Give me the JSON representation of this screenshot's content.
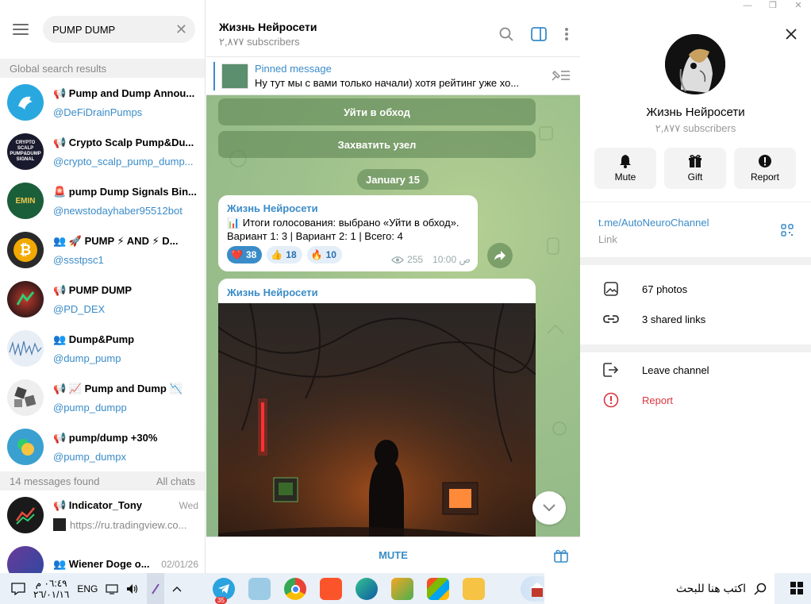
{
  "window": {
    "minimize": "—",
    "restore": "❐",
    "close": "✕"
  },
  "left_panel": {
    "search": {
      "value": "PUMP DUMP"
    },
    "global_header": "Global search results",
    "global_results": [
      {
        "title": "📢 Pump and Dump Annou...",
        "sub": "@DeFiDrainPumps",
        "avatar_color": "#29a8e0"
      },
      {
        "title": "📢 Crypto Scalp Pump&Du...",
        "sub": "@crypto_scalp_pump_dump...",
        "avatar_color": "#1a1a2e",
        "avatar_text": "CRYPTO SCALP PUMP&DUMP SIGNAL"
      },
      {
        "title": "🚨 pump Dump Signals Bin...",
        "sub": "@newstodayhaber95512bot",
        "avatar_color": "#1b5e3a",
        "avatar_text": "EMIN"
      },
      {
        "title": "👥 🚀 PUMP ⚡ AND ⚡ D...",
        "sub": "@ssstpsc1",
        "avatar_color": "#2a2a2a"
      },
      {
        "title": "📢 PUMP DUMP",
        "sub": "@PD_DEX",
        "avatar_color": "#3a1a1a"
      },
      {
        "title": "👥 Dump&Pump",
        "sub": "@dump_pump",
        "avatar_color": "#e8eef6"
      },
      {
        "title": "📢 📈 Pump and Dump 📉",
        "sub": "@pump_dumpp",
        "avatar_color": "#eeeeee"
      },
      {
        "title": "📢 pump/dump +30%",
        "sub": "@pump_dumpx",
        "avatar_color": "#3aa0d0"
      }
    ],
    "messages_header": {
      "left": "14 messages found",
      "right": "All chats"
    },
    "message_results": [
      {
        "title": "📢 Indicator_Tony",
        "date": "Wed",
        "sub": "https://ru.tradingview.co...",
        "avatar_color": "#1a1a1a"
      },
      {
        "title": "👥 Wiener Doge o...",
        "date": "02/01/26",
        "sub": "",
        "avatar_color": "#4a2a6a"
      }
    ]
  },
  "chat": {
    "title": "Жизнь Нейросети",
    "subscribers": "٢,٨٧٧ subscribers",
    "pinned": {
      "label": "Pinned message",
      "text": "Ну тут мы с вами только начали) хотя рейтинг уже хо..."
    },
    "keyboard_buttons": [
      "Уйти в обход",
      "Захватить узел"
    ],
    "date_pill": "January 15",
    "poll_message": {
      "author": "Жизнь Нейросети",
      "line1": "📊 Итоги голосования: выбрано «Уйти в обход».",
      "line2": "Вариант 1: 3 | Вариант 2: 1 | Всего: 4",
      "reactions": [
        {
          "emoji": "❤️",
          "count": "38"
        },
        {
          "emoji": "👍",
          "count": "18"
        },
        {
          "emoji": "🔥",
          "count": "10"
        }
      ],
      "views": "255",
      "time": "10:00 ص"
    },
    "image_message": {
      "author": "Жизнь Нейросети"
    },
    "bottom_action": "MUTE"
  },
  "profile": {
    "name": "Жизнь Нейросети",
    "subscribers": "٢,٨٧٧ subscribers",
    "actions": [
      {
        "label": "Mute",
        "icon": "bell-icon"
      },
      {
        "label": "Gift",
        "icon": "gift-icon"
      },
      {
        "label": "Report",
        "icon": "alert-icon"
      }
    ],
    "link": {
      "value": "t.me/AutoNeuroChannel",
      "label": "Link"
    },
    "media": {
      "photos": "67 photos",
      "links": "3 shared links"
    },
    "leave": "Leave channel",
    "report": "Report"
  },
  "taskbar": {
    "search_placeholder": "اكتب هنا للبحث",
    "language": "ENG",
    "time": "٠٦:٤٩ م",
    "date": "٢٦/٠١/١٦",
    "telegram_badge": "35"
  }
}
